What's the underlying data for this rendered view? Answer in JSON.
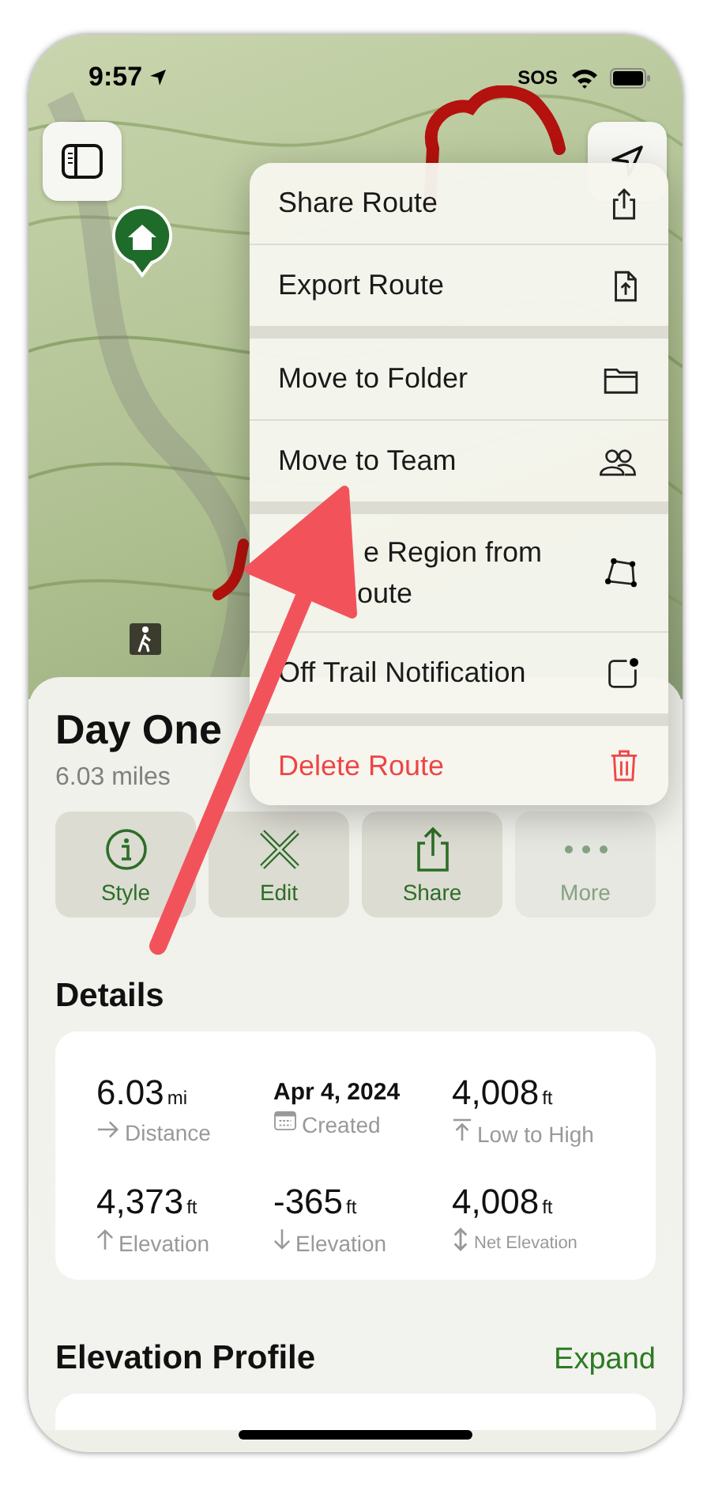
{
  "status_bar": {
    "time": "9:57",
    "sos": "SOS"
  },
  "menu": {
    "sections": [
      [
        {
          "label": "Share Route",
          "kind": "normal"
        },
        {
          "label": "Export Route",
          "kind": "normal"
        }
      ],
      [
        {
          "label": "Move to Folder",
          "kind": "normal"
        },
        {
          "label": "Move to Team",
          "kind": "normal"
        }
      ],
      [
        {
          "label_lines": [
            "e Region from",
            "oute"
          ],
          "kind": "covered"
        },
        {
          "label": "Off Trail Notification",
          "kind": "normal"
        }
      ],
      [
        {
          "label": "Delete Route",
          "kind": "destructive"
        }
      ]
    ]
  },
  "route": {
    "title": "Day One",
    "subtitle": "6.03 miles",
    "actions": [
      {
        "label": "Style",
        "disabled": false
      },
      {
        "label": "Edit",
        "disabled": false
      },
      {
        "label": "Share",
        "disabled": false
      },
      {
        "label": "More",
        "disabled": true
      }
    ]
  },
  "details": {
    "heading": "Details",
    "stats": [
      {
        "value": "6.03",
        "unit": "mi",
        "label": "Distance",
        "kind": "big"
      },
      {
        "value": "Apr 4, 2024",
        "label": "Created",
        "kind": "date"
      },
      {
        "value": "4,008",
        "unit": "ft",
        "label": "Low to High",
        "kind": "big"
      },
      {
        "value": "4,373",
        "unit": "ft",
        "label": "Elevation",
        "kind": "big"
      },
      {
        "value": "-365",
        "unit": "ft",
        "label": "Elevation",
        "kind": "big"
      },
      {
        "value": "4,008",
        "unit": "ft",
        "label": "Net Elevation",
        "kind": "big"
      }
    ]
  },
  "elevation_profile": {
    "heading": "Elevation Profile",
    "link": "Expand"
  }
}
